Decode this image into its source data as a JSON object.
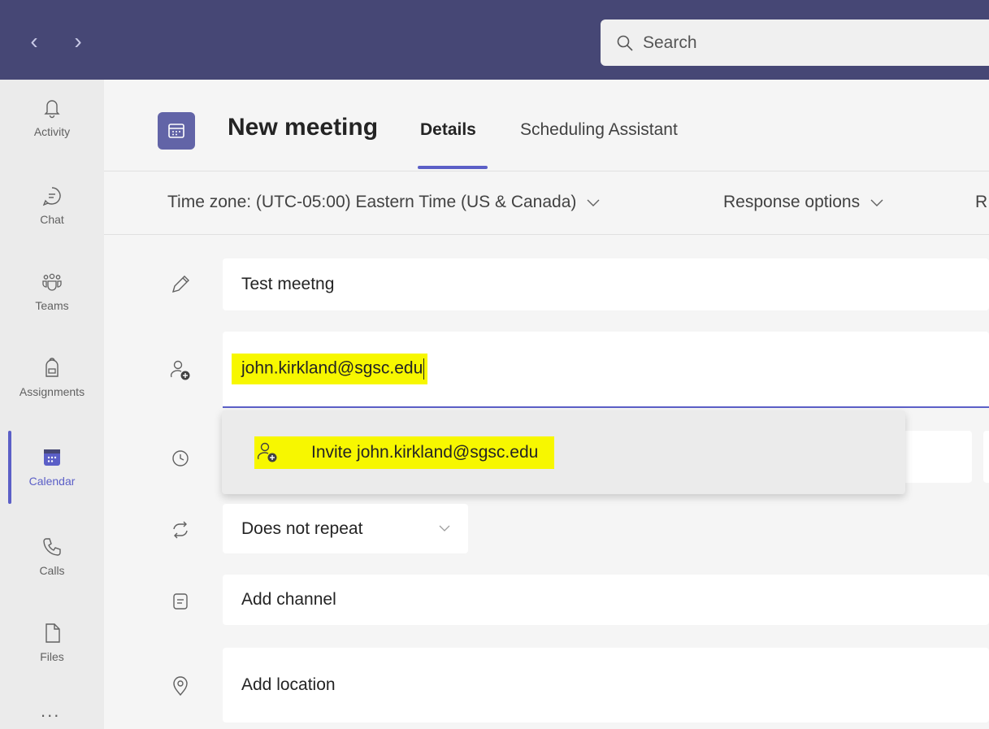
{
  "topbar": {
    "back_label": "‹",
    "forward_label": "›",
    "search_placeholder": "Search"
  },
  "rail": {
    "items": [
      {
        "label": "Activity",
        "icon": "bell-icon"
      },
      {
        "label": "Chat",
        "icon": "chat-icon"
      },
      {
        "label": "Teams",
        "icon": "teams-icon"
      },
      {
        "label": "Assignments",
        "icon": "backpack-icon"
      },
      {
        "label": "Calendar",
        "icon": "calendar-icon",
        "active": true
      },
      {
        "label": "Calls",
        "icon": "phone-icon"
      },
      {
        "label": "Files",
        "icon": "file-icon"
      }
    ],
    "more_label": "..."
  },
  "header": {
    "title": "New meeting",
    "tabs": [
      {
        "label": "Details",
        "active": true
      },
      {
        "label": "Scheduling Assistant"
      }
    ]
  },
  "toolbar": {
    "time_zone": "Time zone: (UTC-05:00) Eastern Time (US & Canada)",
    "response_options": "Response options",
    "cut_label": "R"
  },
  "form": {
    "title_value": "Test meetng",
    "attendee_value": "john.kirkland@sgsc.edu",
    "invite_suggestion": "Invite john.kirkland@sgsc.edu",
    "repeat_value": "Does not repeat",
    "channel_placeholder": "Add channel",
    "location_placeholder": "Add location"
  },
  "colors": {
    "topbar": "#464775",
    "accent": "#5b5fc7",
    "highlight": "#f7f700"
  }
}
